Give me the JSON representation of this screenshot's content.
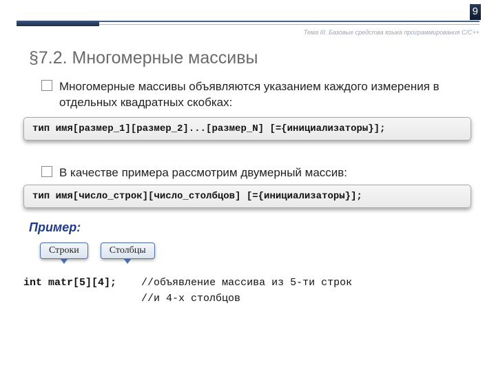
{
  "page_number": "9",
  "header_text": "Тема III. Базовые средства языка программирования С/С++",
  "title": "§7.2. Многомерные массивы",
  "bullet1": "Многомерные массивы объявляются указанием каждого измерения в отдельных квадратных скобках:",
  "syntax1": "тип имя[размер_1][размер_2]...[размер_N] [={инициализаторы}];",
  "bullet2": "В качестве примера рассмотрим двумерный массив:",
  "syntax2": "тип имя[число_строк][число_столбцов] [={инициализаторы}];",
  "example_label": "Пример:",
  "tag_rows": "Строки",
  "tag_cols": "Столбцы",
  "decl_code": "int matr[5][4];",
  "decl_comment1": "//объявление массива из 5-ти строк",
  "decl_comment2": "//и 4-х столбцов"
}
